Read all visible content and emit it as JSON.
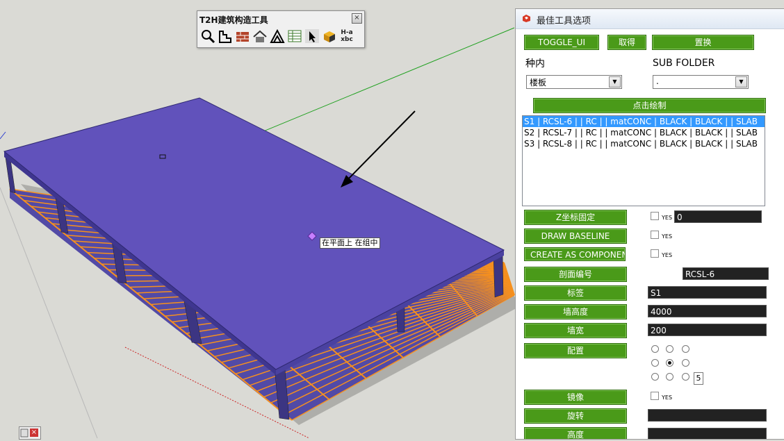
{
  "toolbar": {
    "title": "T2H建筑构造工具",
    "close_glyph": "×",
    "icons": [
      "magnifier-icon",
      "stair-icon",
      "brick-wall-icon",
      "roof-icon",
      "truss-icon",
      "table-icon",
      "cursor-icon",
      "box-icon"
    ],
    "hxbc_label_top": "H-a",
    "hxbc_label_bottom": "xbc"
  },
  "viewport": {
    "tooltip": "在平面上  在组中",
    "slab_color": "#6152bb",
    "column_color": "#3c3582",
    "grid_color": "#f6901e"
  },
  "dialog": {
    "title": "最佳工具选项",
    "buttons": {
      "toggle_ui": "TOGGLE_UI",
      "get": "取得",
      "replace": "置换",
      "draw": "点击绘制"
    },
    "category_label": "种内",
    "subfolder_label": "SUB FOLDER",
    "category_value": "楼板",
    "subfolder_value": ".",
    "list": [
      "S1 | RCSL-6 | | RC | | matCONC | BLACK | BLACK | | SLAB",
      "S2 | RCSL-7 | | RC | | matCONC | BLACK | BLACK | | SLAB",
      "S3 | RCSL-8 | | RC | | matCONC | BLACK | BLACK | | SLAB"
    ],
    "selected_index": 0,
    "fields": {
      "z_fixed": "Z坐标固定",
      "draw_baseline": "DRAW BASELINE",
      "create_component": "CREATE AS COMPONENT",
      "section_no": "剖面编号",
      "tag": "标签",
      "wall_height": "墙高度",
      "wall_width": "墙宽",
      "placement": "配置",
      "mirror": "镜像",
      "rotate": "旋转",
      "height": "高度"
    },
    "yes": "YES",
    "values": {
      "z": "0",
      "section": "RCSL-6",
      "tag": "S1",
      "wall_height": "4000",
      "wall_width": "200",
      "rotate": "",
      "height": ""
    },
    "placement_count": "5",
    "placement_selected": "center",
    "accent": "#4a9a19"
  },
  "mini_icons": {
    "glyph": "×"
  }
}
